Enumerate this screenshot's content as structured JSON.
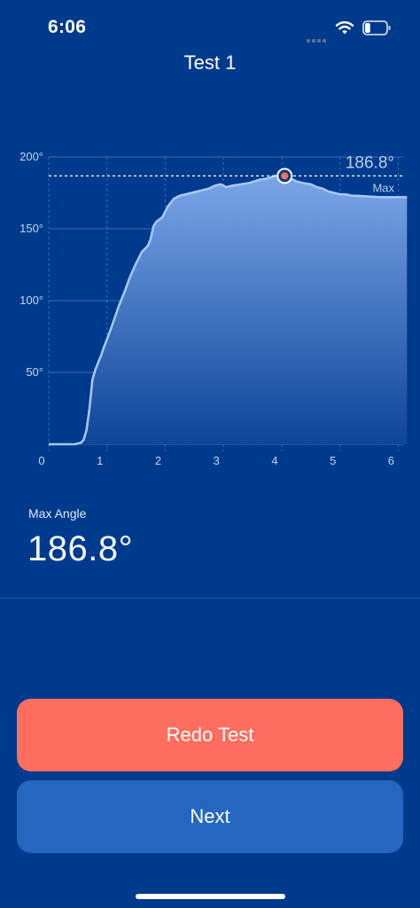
{
  "status_bar": {
    "time": "6:06",
    "signal_icon": "cellular-signal-icon",
    "wifi_icon": "wifi-icon",
    "battery_icon": "battery-icon",
    "battery_level": 0.25
  },
  "nav": {
    "title": "Test 1"
  },
  "chart_data": {
    "type": "area",
    "x": [
      0,
      0.3,
      0.38,
      0.45,
      0.55,
      0.6,
      0.65,
      0.7,
      0.75,
      0.8,
      0.9,
      0.95,
      1.0,
      1.1,
      1.2,
      1.3,
      1.4,
      1.5,
      1.6,
      1.7,
      1.75,
      1.8,
      1.85,
      1.95,
      2.05,
      2.15,
      2.25,
      2.35,
      2.45,
      2.55,
      2.65,
      2.75,
      2.85,
      2.95,
      3.05,
      3.15,
      3.3,
      3.45,
      3.6,
      3.75,
      3.9,
      4.0,
      4.05,
      4.15,
      4.25,
      4.35,
      4.5,
      4.6,
      4.7,
      4.8,
      4.9,
      5.0,
      5.1,
      5.2,
      5.3,
      5.5,
      5.7,
      5.9,
      6.05,
      6.15
    ],
    "y": [
      0,
      0,
      0,
      0,
      1,
      3,
      10,
      25,
      45,
      52,
      62,
      68,
      73,
      84,
      96,
      106,
      117,
      126,
      134,
      138,
      143,
      152,
      155,
      158,
      166,
      171,
      173,
      174,
      175,
      176,
      177,
      178,
      180,
      181,
      179,
      180,
      181,
      182,
      184,
      185,
      187,
      186.8,
      186,
      185,
      183,
      182,
      181,
      179,
      178,
      176,
      175,
      174,
      174,
      173,
      173,
      172.5,
      172,
      172,
      172,
      172
    ],
    "xlabel": "",
    "ylabel": "",
    "xticks": [
      "0",
      "1",
      "2",
      "3",
      "4",
      "5",
      "6"
    ],
    "yticks": [
      "50°",
      "100°",
      "150°",
      "200°"
    ],
    "xlim": [
      0,
      6.1
    ],
    "ylim": [
      0,
      200
    ],
    "grid": true,
    "max_marker": {
      "x": 4.05,
      "y": 186.8,
      "value_label": "186.8°",
      "label": "Max"
    },
    "colors": {
      "line": "#a9c9ff",
      "area_top": "#7aa6e8",
      "area_bottom": "#0e4598",
      "marker": "#ff6e5e"
    }
  },
  "metric": {
    "label": "Max Angle",
    "value": "186.8°"
  },
  "buttons": {
    "redo_label": "Redo Test",
    "next_label": "Next"
  },
  "colors": {
    "background": "#003a8c",
    "redo": "#ff6e5e",
    "next": "#2566bf"
  }
}
